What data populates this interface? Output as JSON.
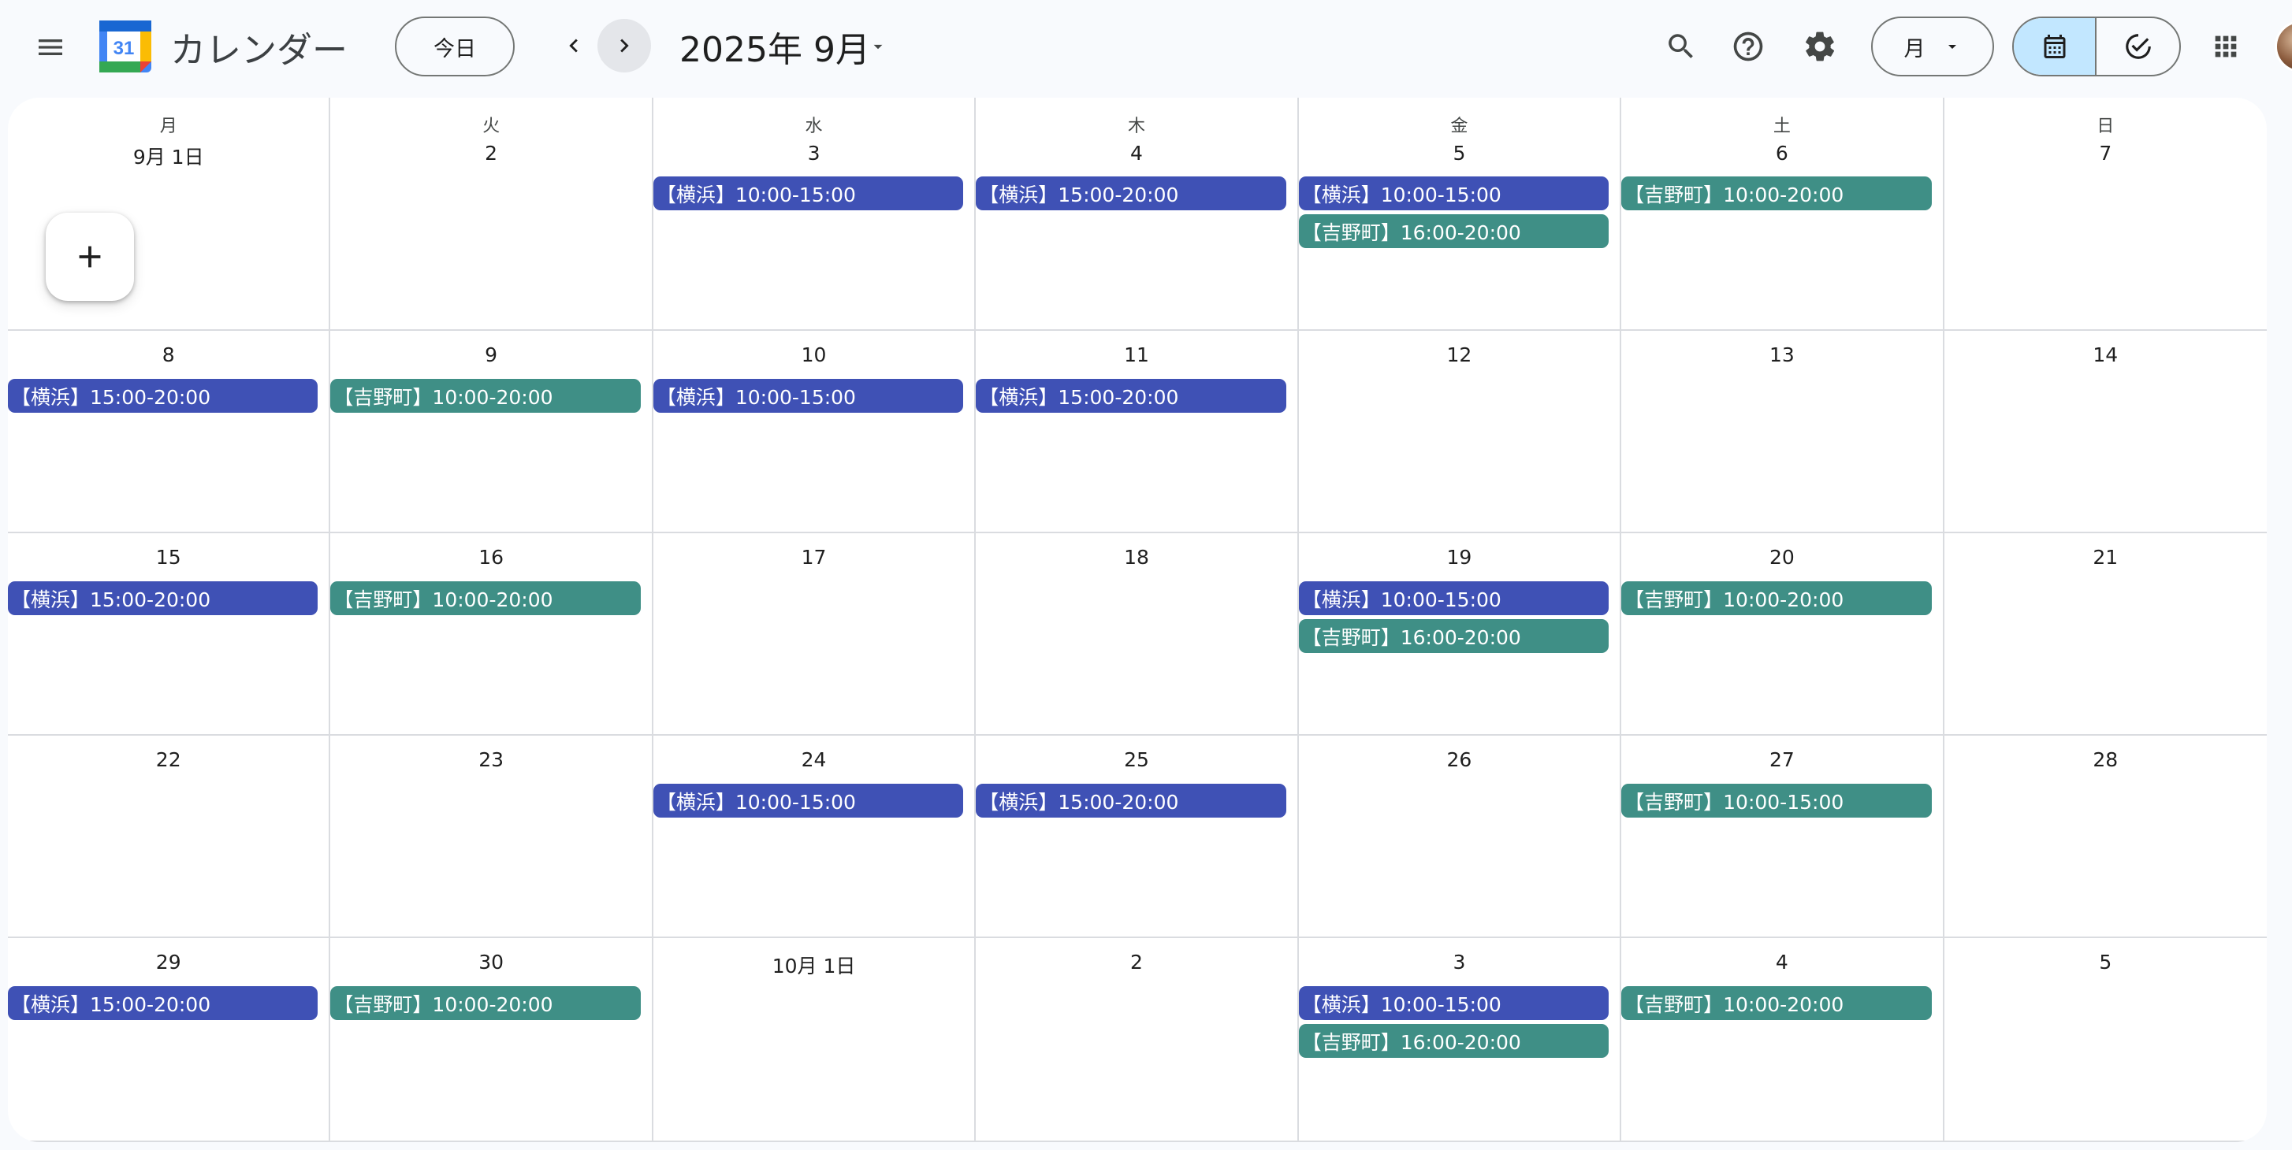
{
  "app": {
    "title": "カレンダー",
    "logo_number": "31",
    "today_label": "今日",
    "current_month": "2025年 9月",
    "view_select_label": "月"
  },
  "colors": {
    "yokohama": "#3f51b5",
    "yoshino": "#3f8f86",
    "toggle_active": "#c2e7ff"
  },
  "icons": {
    "menu": "menu-icon",
    "prev": "chevron-left-icon",
    "next": "chevron-right-icon",
    "search": "search-icon",
    "help": "help-icon",
    "settings": "gear-icon",
    "calendar_view": "calendar-icon",
    "tasks_view": "task-check-icon",
    "apps": "apps-grid-icon",
    "create": "plus-icon"
  },
  "weekdays": [
    "月",
    "火",
    "水",
    "木",
    "金",
    "土",
    "日"
  ],
  "weeks": [
    [
      {
        "label": "9月 1日",
        "events": []
      },
      {
        "label": "2",
        "events": []
      },
      {
        "label": "3",
        "events": [
          {
            "text": "【横浜】10:00-15:00",
            "color": "yokohama"
          }
        ]
      },
      {
        "label": "4",
        "events": [
          {
            "text": "【横浜】15:00-20:00",
            "color": "yokohama"
          }
        ]
      },
      {
        "label": "5",
        "events": [
          {
            "text": "【横浜】10:00-15:00",
            "color": "yokohama"
          },
          {
            "text": "【吉野町】16:00-20:00",
            "color": "yoshino"
          }
        ]
      },
      {
        "label": "6",
        "events": [
          {
            "text": "【吉野町】10:00-20:00",
            "color": "yoshino"
          }
        ]
      },
      {
        "label": "7",
        "events": []
      }
    ],
    [
      {
        "label": "8",
        "events": [
          {
            "text": "【横浜】15:00-20:00",
            "color": "yokohama"
          }
        ]
      },
      {
        "label": "9",
        "events": [
          {
            "text": "【吉野町】10:00-20:00",
            "color": "yoshino"
          }
        ]
      },
      {
        "label": "10",
        "events": [
          {
            "text": "【横浜】10:00-15:00",
            "color": "yokohama"
          }
        ]
      },
      {
        "label": "11",
        "events": [
          {
            "text": "【横浜】15:00-20:00",
            "color": "yokohama"
          }
        ]
      },
      {
        "label": "12",
        "events": []
      },
      {
        "label": "13",
        "events": []
      },
      {
        "label": "14",
        "events": []
      }
    ],
    [
      {
        "label": "15",
        "events": [
          {
            "text": "【横浜】15:00-20:00",
            "color": "yokohama"
          }
        ]
      },
      {
        "label": "16",
        "events": [
          {
            "text": "【吉野町】10:00-20:00",
            "color": "yoshino"
          }
        ]
      },
      {
        "label": "17",
        "events": []
      },
      {
        "label": "18",
        "events": []
      },
      {
        "label": "19",
        "events": [
          {
            "text": "【横浜】10:00-15:00",
            "color": "yokohama"
          },
          {
            "text": "【吉野町】16:00-20:00",
            "color": "yoshino"
          }
        ]
      },
      {
        "label": "20",
        "events": [
          {
            "text": "【吉野町】10:00-20:00",
            "color": "yoshino"
          }
        ]
      },
      {
        "label": "21",
        "events": []
      }
    ],
    [
      {
        "label": "22",
        "events": []
      },
      {
        "label": "23",
        "events": []
      },
      {
        "label": "24",
        "events": [
          {
            "text": "【横浜】10:00-15:00",
            "color": "yokohama"
          }
        ]
      },
      {
        "label": "25",
        "events": [
          {
            "text": "【横浜】15:00-20:00",
            "color": "yokohama"
          }
        ]
      },
      {
        "label": "26",
        "events": []
      },
      {
        "label": "27",
        "events": [
          {
            "text": "【吉野町】10:00-15:00",
            "color": "yoshino"
          }
        ]
      },
      {
        "label": "28",
        "events": []
      }
    ],
    [
      {
        "label": "29",
        "events": [
          {
            "text": "【横浜】15:00-20:00",
            "color": "yokohama"
          }
        ]
      },
      {
        "label": "30",
        "events": [
          {
            "text": "【吉野町】10:00-20:00",
            "color": "yoshino"
          }
        ]
      },
      {
        "label": "10月 1日",
        "events": []
      },
      {
        "label": "2",
        "events": []
      },
      {
        "label": "3",
        "events": [
          {
            "text": "【横浜】10:00-15:00",
            "color": "yokohama"
          },
          {
            "text": "【吉野町】16:00-20:00",
            "color": "yoshino"
          }
        ]
      },
      {
        "label": "4",
        "events": [
          {
            "text": "【吉野町】10:00-20:00",
            "color": "yoshino"
          }
        ]
      },
      {
        "label": "5",
        "events": []
      }
    ]
  ]
}
